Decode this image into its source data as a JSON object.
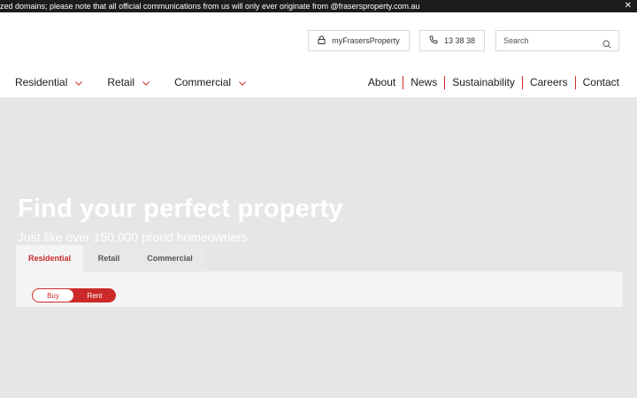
{
  "alert": {
    "text": "zed domains; please note that all official communications from us will only ever originate from @frasersproperty.com.au",
    "close_glyph": "✕"
  },
  "utility": {
    "my_frasers_label": "myFrasersProperty",
    "phone_label": "13 38 38",
    "search_placeholder": "Search"
  },
  "nav": {
    "dropdowns": [
      {
        "label": "Residential"
      },
      {
        "label": "Retail"
      },
      {
        "label": "Commercial"
      }
    ],
    "links": [
      {
        "label": "About"
      },
      {
        "label": "News"
      },
      {
        "label": "Sustainability"
      },
      {
        "label": "Careers"
      },
      {
        "label": "Contact"
      }
    ]
  },
  "hero": {
    "title": "Find your perfect property",
    "subtitle": "Just like over 150,000 proud homeowners"
  },
  "search_panel": {
    "tabs": [
      {
        "label": "Residential",
        "active": true
      },
      {
        "label": "Retail",
        "active": false
      },
      {
        "label": "Commercial",
        "active": false
      }
    ],
    "toggle": {
      "buy_label": "Buy",
      "rent_label": "Rent",
      "selected": "Buy"
    }
  },
  "colors": {
    "accent": "#cc2a2a",
    "alert_bg": "#1c1c1c",
    "hero_bg": "#e6e6e6"
  }
}
